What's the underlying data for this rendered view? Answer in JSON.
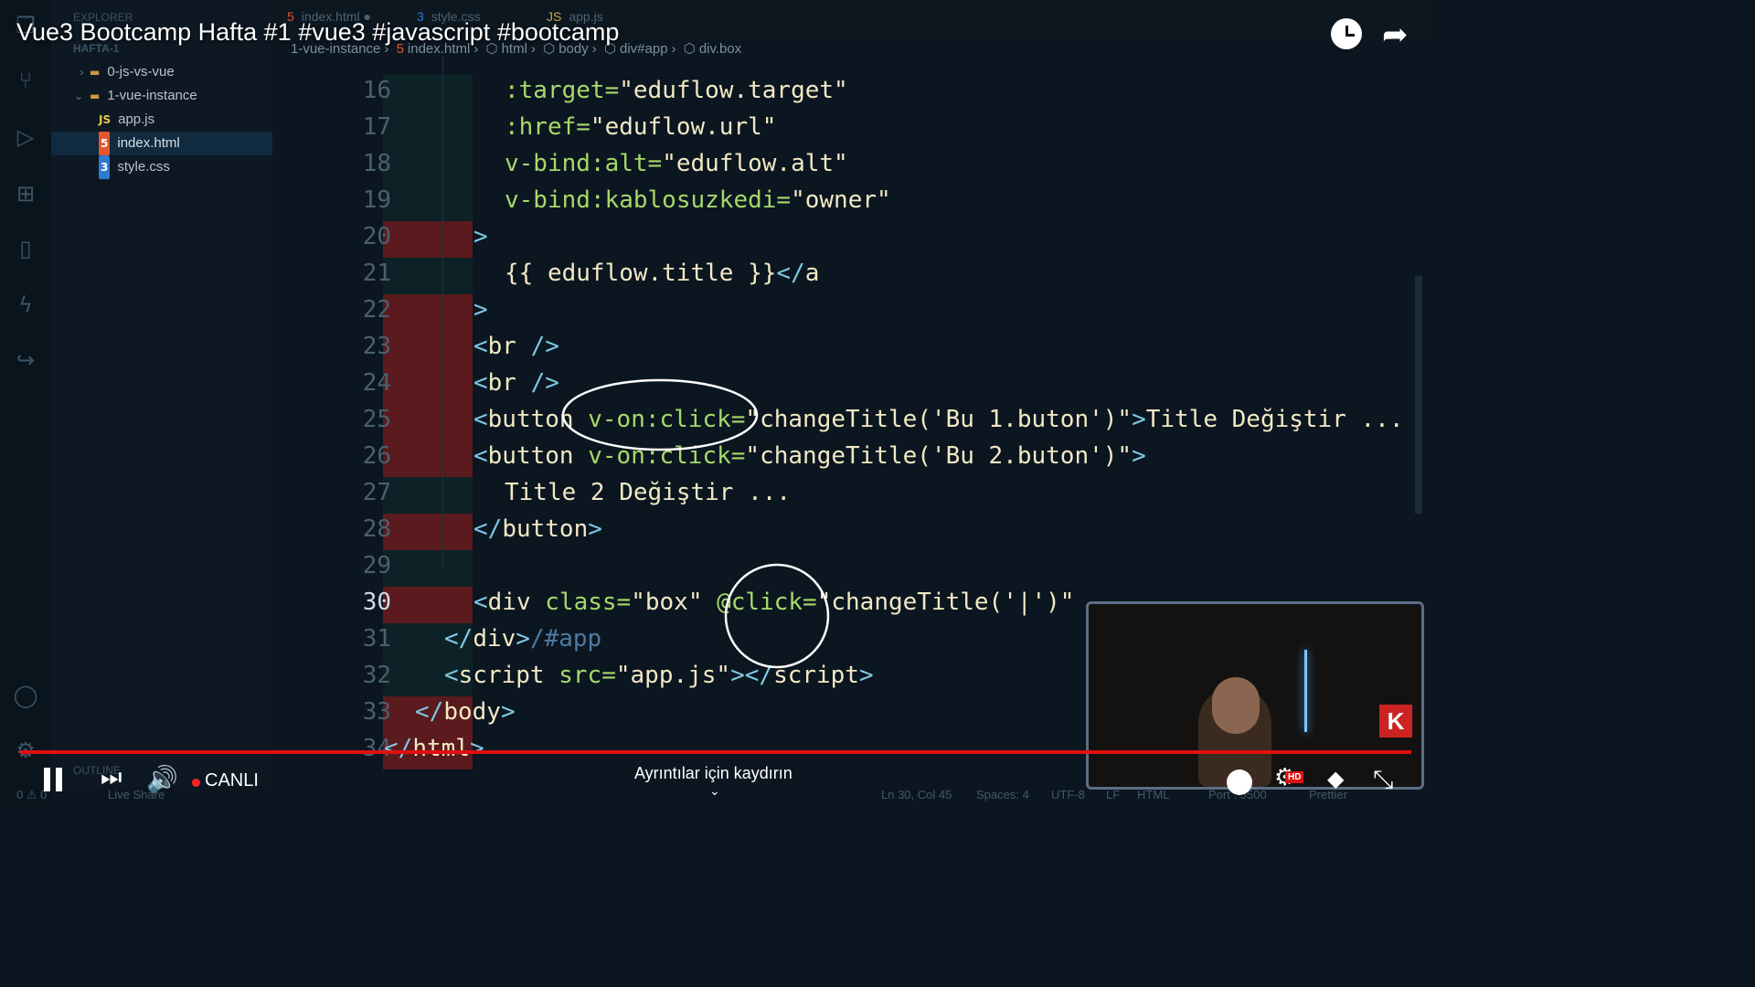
{
  "video": {
    "title": "Vue3 Bootcamp Hafta #1 #vue3 #javascript #bootcamp",
    "live_label": "CANLI",
    "scroll_hint": "Ayrıntılar için kaydırın",
    "hd_badge": "HD"
  },
  "editor": {
    "sidebar_header": "EXPLORER",
    "workspace": "HAFTA-1",
    "tree": [
      {
        "label": "0-js-vs-vue",
        "kind": "folder"
      },
      {
        "label": "1-vue-instance",
        "kind": "folder-open"
      },
      {
        "label": "app.js",
        "kind": "js",
        "icon": "JS"
      },
      {
        "label": "index.html",
        "kind": "html",
        "icon": "5",
        "selected": true
      },
      {
        "label": "style.css",
        "kind": "css",
        "icon": "3"
      }
    ],
    "tabs": [
      {
        "label": "index.html"
      },
      {
        "label": "style.css"
      },
      {
        "label": "app.js"
      }
    ],
    "breadcrumb": [
      "1-vue-instance",
      "index.html",
      "html",
      "body",
      "div#app",
      "div.box"
    ],
    "line_numbers": [
      "16",
      "17",
      "18",
      "19",
      "20",
      "21",
      "22",
      "23",
      "24",
      "25",
      "26",
      "27",
      "28",
      "29",
      "30",
      "31",
      "32",
      "33",
      "34"
    ],
    "current_line": "30",
    "code": [
      [
        {
          "t": "attr",
          "v": ":target="
        },
        {
          "t": "str",
          "v": "\"eduflow.target\""
        }
      ],
      [
        {
          "t": "attr",
          "v": ":href="
        },
        {
          "t": "str",
          "v": "\"eduflow.url\""
        }
      ],
      [
        {
          "t": "attr",
          "v": "v-bind:alt="
        },
        {
          "t": "str",
          "v": "\"eduflow.alt\""
        }
      ],
      [
        {
          "t": "attr",
          "v": "v-bind:kablosuzkedi="
        },
        {
          "t": "str",
          "v": "\"owner\""
        }
      ],
      [
        {
          "t": "tag",
          "v": ">"
        }
      ],
      [
        {
          "t": "text",
          "v": "{{ eduflow.title }}"
        },
        {
          "t": "tag",
          "v": "</"
        },
        {
          "t": "text",
          "v": "a"
        }
      ],
      [
        {
          "t": "tag",
          "v": ">"
        }
      ],
      [
        {
          "t": "tag",
          "v": "<"
        },
        {
          "t": "text",
          "v": "br "
        },
        {
          "t": "tag",
          "v": "/>"
        }
      ],
      [
        {
          "t": "tag",
          "v": "<"
        },
        {
          "t": "text",
          "v": "br "
        },
        {
          "t": "tag",
          "v": "/>"
        }
      ],
      [
        {
          "t": "tag",
          "v": "<"
        },
        {
          "t": "text",
          "v": "button "
        },
        {
          "t": "attr",
          "v": "v-on:click="
        },
        {
          "t": "str",
          "v": "\"changeTitle('Bu 1.buton')\""
        },
        {
          "t": "tag",
          "v": ">"
        },
        {
          "t": "text",
          "v": "Title Değiştir ..."
        }
      ],
      [
        {
          "t": "tag",
          "v": "<"
        },
        {
          "t": "text",
          "v": "button "
        },
        {
          "t": "attr",
          "v": "v-on:click="
        },
        {
          "t": "str",
          "v": "\"changeTitle('Bu 2.buton')\""
        },
        {
          "t": "tag",
          "v": ">"
        }
      ],
      [
        {
          "t": "text",
          "v": "Title 2 Değiştir ..."
        }
      ],
      [
        {
          "t": "tag",
          "v": "</"
        },
        {
          "t": "text",
          "v": "button"
        },
        {
          "t": "tag",
          "v": ">"
        }
      ],
      [],
      [
        {
          "t": "tag",
          "v": "<"
        },
        {
          "t": "text",
          "v": "div "
        },
        {
          "t": "attr",
          "v": "class="
        },
        {
          "t": "str",
          "v": "\"box\" "
        },
        {
          "t": "attr",
          "v": "@click="
        },
        {
          "t": "str",
          "v": "\"changeTitle('|')\""
        }
      ],
      [
        {
          "t": "tag",
          "v": "</"
        },
        {
          "t": "text",
          "v": "div"
        },
        {
          "t": "tag",
          "v": ">"
        },
        {
          "t": "com",
          "v": "/#app"
        }
      ],
      [
        {
          "t": "tag",
          "v": "<"
        },
        {
          "t": "text",
          "v": "script "
        },
        {
          "t": "attr",
          "v": "src="
        },
        {
          "t": "str",
          "v": "\"app.js\""
        },
        {
          "t": "tag",
          "v": "></"
        },
        {
          "t": "text",
          "v": "script"
        },
        {
          "t": "tag",
          "v": ">"
        }
      ],
      [
        {
          "t": "tag",
          "v": "</"
        },
        {
          "t": "text",
          "v": "body"
        },
        {
          "t": "tag",
          "v": ">"
        }
      ],
      [
        {
          "t": "tag",
          "v": "</"
        },
        {
          "t": "text",
          "v": "html"
        },
        {
          "t": "tag",
          "v": ">"
        }
      ]
    ],
    "status": {
      "position": "Ln 30, Col 45",
      "spaces": "Spaces: 4",
      "encoding": "UTF-8",
      "eol": "LF",
      "language": "HTML",
      "port": "Port : 5500",
      "formatter": "Prettier",
      "outline": "OUTLINE",
      "live_share": "Live Share",
      "problems": "0 ⚠ 0"
    }
  },
  "colors": {
    "progress": "#e01010",
    "accent_live": "#ff2020"
  },
  "icons": [
    "explorer-icon",
    "search-icon",
    "source-control-icon",
    "run-debug-icon",
    "extensions-icon",
    "bookmark-icon",
    "lightning-icon",
    "share-icon",
    "account-icon",
    "settings-icon",
    "clock-icon",
    "share-arrow-icon",
    "pause-icon",
    "next-icon",
    "volume-icon",
    "settings-gear-icon",
    "fullscreen-exit-icon"
  ]
}
